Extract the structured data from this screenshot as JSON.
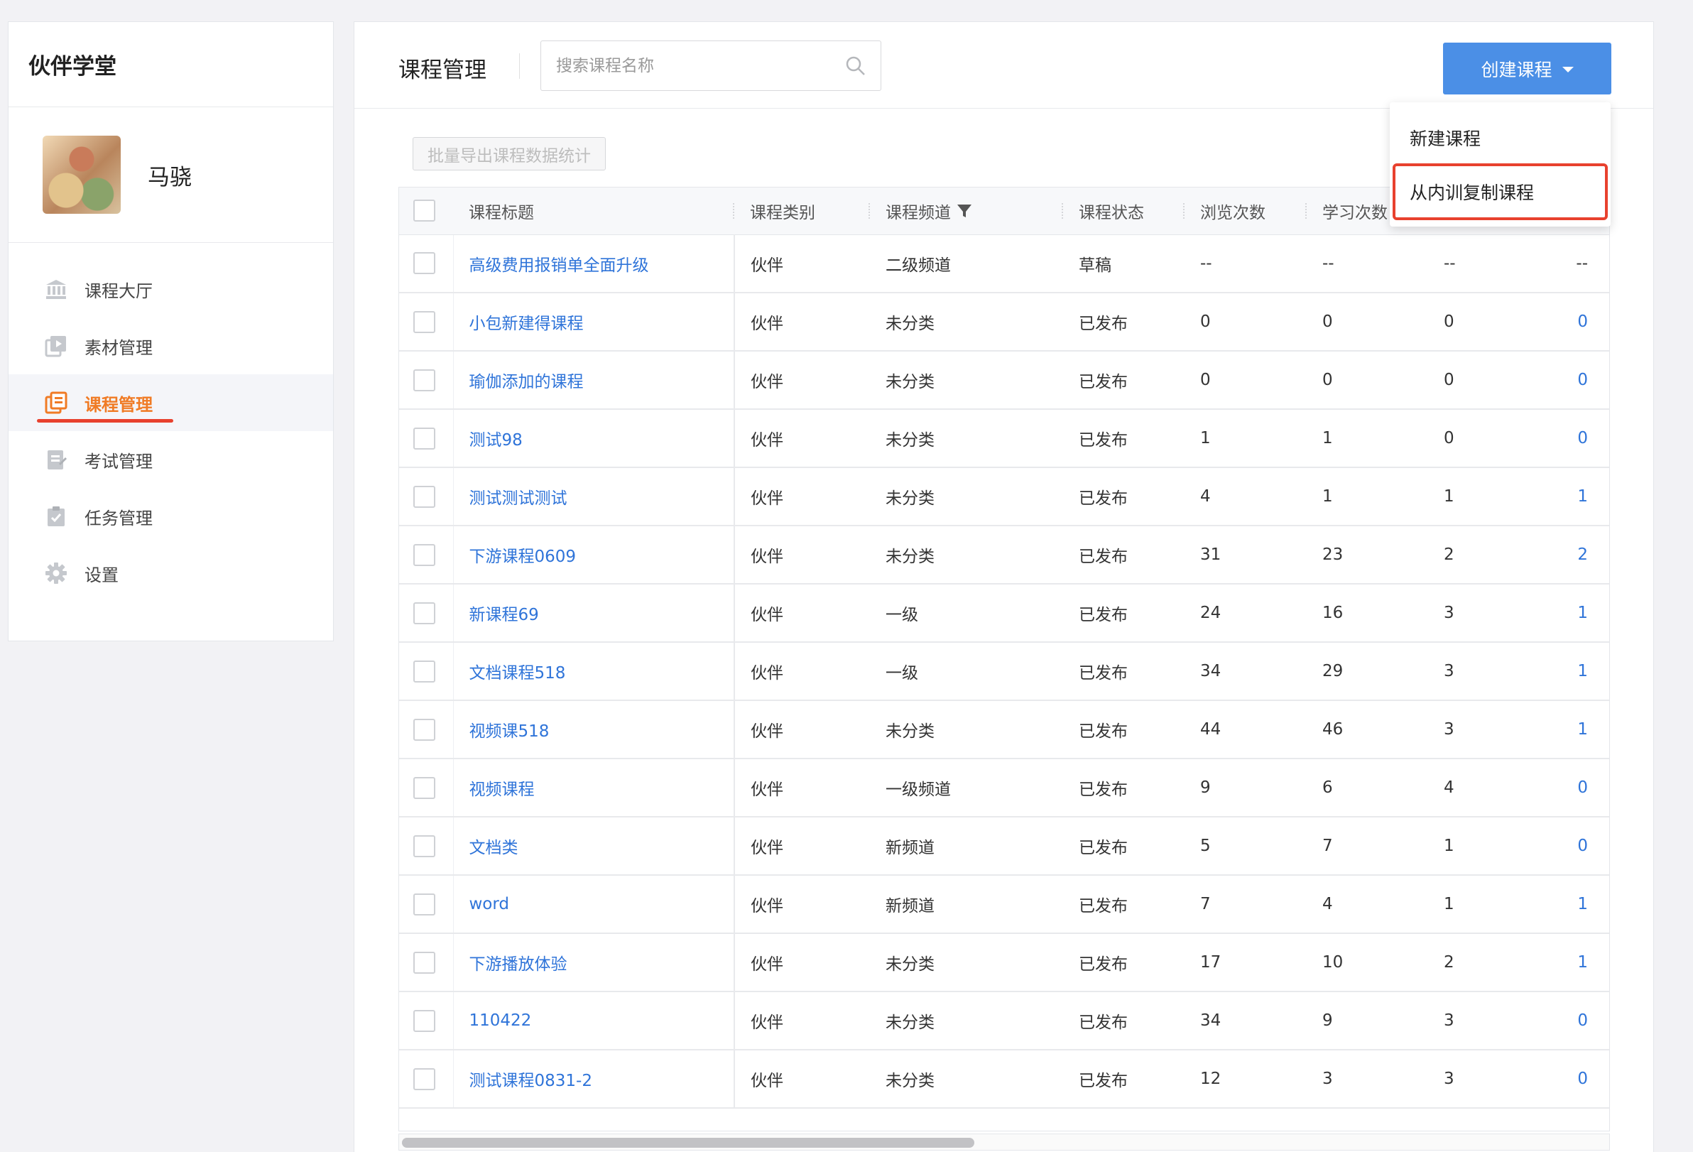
{
  "sidebar": {
    "brand": "伙伴学堂",
    "user_name": "马骁",
    "menu": [
      {
        "label": "课程大厅",
        "icon": "bank-icon"
      },
      {
        "label": "素材管理",
        "icon": "media-icon"
      },
      {
        "label": "课程管理",
        "icon": "course-icon",
        "active": true
      },
      {
        "label": "考试管理",
        "icon": "exam-icon"
      },
      {
        "label": "任务管理",
        "icon": "task-icon"
      },
      {
        "label": "设置",
        "icon": "gear-icon"
      }
    ]
  },
  "header": {
    "title": "课程管理",
    "search_placeholder": "搜索课程名称",
    "create_button": "创建课程"
  },
  "dropdown": {
    "items": [
      "新建课程",
      "从内训复制课程"
    ]
  },
  "toolbar": {
    "export_label": "批量导出课程数据统计"
  },
  "table": {
    "headers": {
      "title": "课程标题",
      "category": "课程类别",
      "channel": "课程频道",
      "status": "课程状态",
      "views": "浏览次数",
      "study": "学习次数"
    },
    "rows": [
      {
        "title": "高级费用报销单全面升级",
        "category": "伙伴",
        "channel": "二级频道",
        "status": "草稿",
        "c1": "--",
        "c2": "--",
        "c3": "--",
        "c4": "--"
      },
      {
        "title": "小包新建得课程",
        "category": "伙伴",
        "channel": "未分类",
        "status": "已发布",
        "c1": "0",
        "c2": "0",
        "c3": "0",
        "c4": "0"
      },
      {
        "title": "瑜伽添加的课程",
        "category": "伙伴",
        "channel": "未分类",
        "status": "已发布",
        "c1": "0",
        "c2": "0",
        "c3": "0",
        "c4": "0"
      },
      {
        "title": "测试98",
        "category": "伙伴",
        "channel": "未分类",
        "status": "已发布",
        "c1": "1",
        "c2": "1",
        "c3": "0",
        "c4": "0"
      },
      {
        "title": "测试测试测试",
        "category": "伙伴",
        "channel": "未分类",
        "status": "已发布",
        "c1": "4",
        "c2": "1",
        "c3": "1",
        "c4": "1"
      },
      {
        "title": "下游课程0609",
        "category": "伙伴",
        "channel": "未分类",
        "status": "已发布",
        "c1": "31",
        "c2": "23",
        "c3": "2",
        "c4": "2"
      },
      {
        "title": "新课程69",
        "category": "伙伴",
        "channel": "一级",
        "status": "已发布",
        "c1": "24",
        "c2": "16",
        "c3": "3",
        "c4": "1"
      },
      {
        "title": "文档课程518",
        "category": "伙伴",
        "channel": "一级",
        "status": "已发布",
        "c1": "34",
        "c2": "29",
        "c3": "3",
        "c4": "1"
      },
      {
        "title": "视频课518",
        "category": "伙伴",
        "channel": "未分类",
        "status": "已发布",
        "c1": "44",
        "c2": "46",
        "c3": "3",
        "c4": "1"
      },
      {
        "title": "视频课程",
        "category": "伙伴",
        "channel": "一级频道",
        "status": "已发布",
        "c1": "9",
        "c2": "6",
        "c3": "4",
        "c4": "0"
      },
      {
        "title": "文档类",
        "category": "伙伴",
        "channel": "新频道",
        "status": "已发布",
        "c1": "5",
        "c2": "7",
        "c3": "1",
        "c4": "0"
      },
      {
        "title": "word",
        "category": "伙伴",
        "channel": "新频道",
        "status": "已发布",
        "c1": "7",
        "c2": "4",
        "c3": "1",
        "c4": "1"
      },
      {
        "title": "下游播放体验",
        "category": "伙伴",
        "channel": "未分类",
        "status": "已发布",
        "c1": "17",
        "c2": "10",
        "c3": "2",
        "c4": "1"
      },
      {
        "title": "110422",
        "category": "伙伴",
        "channel": "未分类",
        "status": "已发布",
        "c1": "34",
        "c2": "9",
        "c3": "3",
        "c4": "0"
      },
      {
        "title": "测试课程0831-2",
        "category": "伙伴",
        "channel": "未分类",
        "status": "已发布",
        "c1": "12",
        "c2": "3",
        "c3": "3",
        "c4": "0"
      }
    ]
  },
  "colors": {
    "accent": "#4b8fe6",
    "link": "#2f74d9",
    "active_menu": "#f07b25",
    "highlight": "#e8412e"
  }
}
